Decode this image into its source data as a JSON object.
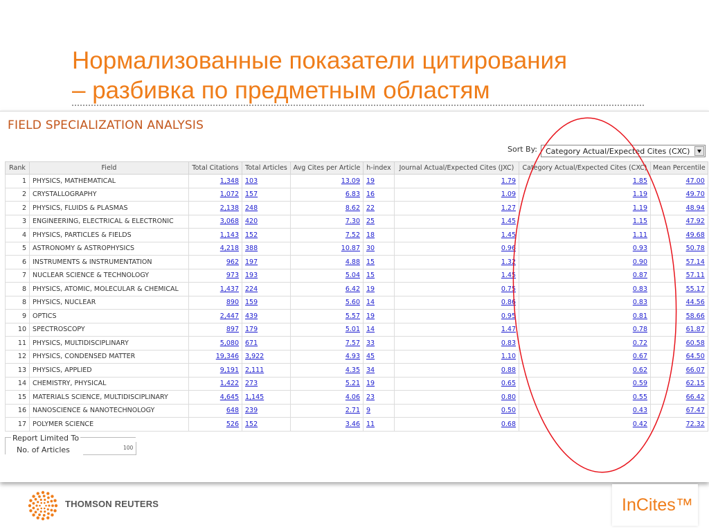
{
  "slide": {
    "title_line1": "Нормализованные показатели цитирования",
    "title_line2": "– разбивка по предметным областям"
  },
  "screen": {
    "heading": "FIELD SPECIALIZATION ANALYSIS",
    "sort_label": "Sort By:",
    "sort_value": "Category Actual/Expected Cites (CXC)",
    "columns": [
      "Rank",
      "Field",
      "Total Citations",
      "Total Articles",
      "Avg Cites per Article",
      "h-index",
      "Journal Actual/Expected Cites (JXC)",
      "Category Actual/Expected Cites (CXC)",
      "Mean Percentile"
    ],
    "rows": [
      {
        "rank": "1",
        "field": "PHYSICS, MATHEMATICAL",
        "citations": "1,348",
        "articles": "103",
        "avg": "13.09",
        "h": "19",
        "jxc": "1.79",
        "cxc": "1.85",
        "pct": "47.00"
      },
      {
        "rank": "2",
        "field": "CRYSTALLOGRAPHY",
        "citations": "1,072",
        "articles": "157",
        "avg": "6.83",
        "h": "16",
        "jxc": "1.09",
        "cxc": "1.19",
        "pct": "49.70"
      },
      {
        "rank": "2",
        "field": "PHYSICS, FLUIDS & PLASMAS",
        "citations": "2,138",
        "articles": "248",
        "avg": "8.62",
        "h": "22",
        "jxc": "1.27",
        "cxc": "1.19",
        "pct": "48.94"
      },
      {
        "rank": "3",
        "field": "ENGINEERING, ELECTRICAL & ELECTRONIC",
        "citations": "3,068",
        "articles": "420",
        "avg": "7.30",
        "h": "25",
        "jxc": "1.45",
        "cxc": "1.15",
        "pct": "47.92"
      },
      {
        "rank": "4",
        "field": "PHYSICS, PARTICLES & FIELDS",
        "citations": "1,143",
        "articles": "152",
        "avg": "7.52",
        "h": "18",
        "jxc": "1.45",
        "cxc": "1.11",
        "pct": "49.68"
      },
      {
        "rank": "5",
        "field": "ASTRONOMY & ASTROPHYSICS",
        "citations": "4,218",
        "articles": "388",
        "avg": "10.87",
        "h": "30",
        "jxc": "0.96",
        "cxc": "0.93",
        "pct": "50.78"
      },
      {
        "rank": "6",
        "field": "INSTRUMENTS & INSTRUMENTATION",
        "citations": "962",
        "articles": "197",
        "avg": "4.88",
        "h": "15",
        "jxc": "1.32",
        "cxc": "0.90",
        "pct": "57.14"
      },
      {
        "rank": "7",
        "field": "NUCLEAR SCIENCE & TECHNOLOGY",
        "citations": "973",
        "articles": "193",
        "avg": "5.04",
        "h": "15",
        "jxc": "1.45",
        "cxc": "0.87",
        "pct": "57.11"
      },
      {
        "rank": "8",
        "field": "PHYSICS, ATOMIC, MOLECULAR & CHEMICAL",
        "citations": "1,437",
        "articles": "224",
        "avg": "6.42",
        "h": "19",
        "jxc": "0.75",
        "cxc": "0.83",
        "pct": "55.17"
      },
      {
        "rank": "8",
        "field": "PHYSICS, NUCLEAR",
        "citations": "890",
        "articles": "159",
        "avg": "5.60",
        "h": "14",
        "jxc": "0.86",
        "cxc": "0.83",
        "pct": "44.56"
      },
      {
        "rank": "9",
        "field": "OPTICS",
        "citations": "2,447",
        "articles": "439",
        "avg": "5.57",
        "h": "19",
        "jxc": "0.95",
        "cxc": "0.81",
        "pct": "58.66"
      },
      {
        "rank": "10",
        "field": "SPECTROSCOPY",
        "citations": "897",
        "articles": "179",
        "avg": "5.01",
        "h": "14",
        "jxc": "1.47",
        "cxc": "0.78",
        "pct": "61.87"
      },
      {
        "rank": "11",
        "field": "PHYSICS, MULTIDISCIPLINARY",
        "citations": "5,080",
        "articles": "671",
        "avg": "7.57",
        "h": "33",
        "jxc": "0.83",
        "cxc": "0.72",
        "pct": "60.58"
      },
      {
        "rank": "12",
        "field": "PHYSICS, CONDENSED MATTER",
        "citations": "19,346",
        "articles": "3,922",
        "avg": "4.93",
        "h": "45",
        "jxc": "1.10",
        "cxc": "0.67",
        "pct": "64.50"
      },
      {
        "rank": "13",
        "field": "PHYSICS, APPLIED",
        "citations": "9,191",
        "articles": "2,111",
        "avg": "4.35",
        "h": "34",
        "jxc": "0.88",
        "cxc": "0.62",
        "pct": "66.07"
      },
      {
        "rank": "14",
        "field": "CHEMISTRY, PHYSICAL",
        "citations": "1,422",
        "articles": "273",
        "avg": "5.21",
        "h": "19",
        "jxc": "0.65",
        "cxc": "0.59",
        "pct": "62.15"
      },
      {
        "rank": "15",
        "field": "MATERIALS SCIENCE, MULTIDISCIPLINARY",
        "citations": "4,645",
        "articles": "1,145",
        "avg": "4.06",
        "h": "23",
        "jxc": "0.80",
        "cxc": "0.55",
        "pct": "66.42"
      },
      {
        "rank": "16",
        "field": "NANOSCIENCE & NANOTECHNOLOGY",
        "citations": "648",
        "articles": "239",
        "avg": "2.71",
        "h": "9",
        "jxc": "0.50",
        "cxc": "0.43",
        "pct": "67.47"
      },
      {
        "rank": "17",
        "field": "POLYMER SCIENCE",
        "citations": "526",
        "articles": "152",
        "avg": "3.46",
        "h": "11",
        "jxc": "0.68",
        "cxc": "0.42",
        "pct": "72.32"
      }
    ],
    "report_legend": "Report Limited To",
    "report_label": "No. of Articles",
    "report_value": "100"
  },
  "footer": {
    "company": "THOMSON REUTERS",
    "product": "InCites™"
  },
  "colors": {
    "title_orange": "#ef7d1a",
    "heading_orange": "#c3561b",
    "link_blue": "#1c1ccf",
    "oval_red": "#e8141c"
  },
  "icons": [
    "thomson-reuters-logo-icon",
    "dropdown-arrow-icon"
  ]
}
